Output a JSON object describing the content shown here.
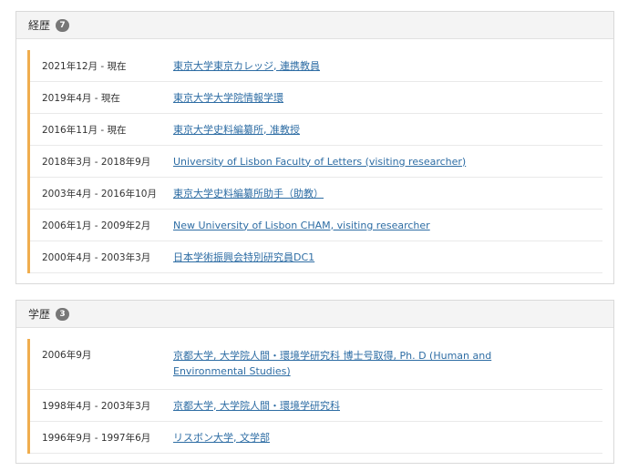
{
  "career": {
    "title": "経歴",
    "count": "7",
    "items": [
      {
        "date": "2021年12月 - 現在",
        "text": "東京大学東京カレッジ, 連携教員"
      },
      {
        "date": "2019年4月 - 現在",
        "text": "東京大学大学院情報学環"
      },
      {
        "date": "2016年11月 - 現在",
        "text": "東京大学史料編纂所, 准教授"
      },
      {
        "date": "2018年3月 - 2018年9月",
        "text": "University of Lisbon Faculty of Letters (visiting researcher)"
      },
      {
        "date": "2003年4月 - 2016年10月",
        "text": "東京大学史料編纂所助手（助教）"
      },
      {
        "date": "2006年1月 - 2009年2月",
        "text": "New University of Lisbon CHAM, visiting researcher"
      },
      {
        "date": "2000年4月 - 2003年3月",
        "text": "日本学術振興会特別研究員DC1"
      }
    ]
  },
  "education": {
    "title": "学歴",
    "count": "3",
    "items": [
      {
        "date": "2006年9月",
        "text": "京都大学, 大学院人間・環境学研究科 博士号取得, Ph. D (Human and Environmental Studies)"
      },
      {
        "date": "1998年4月 - 2003年3月",
        "text": "京都大学, 大学院人間・環境学研究科"
      },
      {
        "date": "1996年9月 - 1997年6月",
        "text": "リスボン大学, 文学部"
      }
    ]
  },
  "colors": {
    "accent": "#f0ad4e",
    "link": "#2e6da4",
    "badge": "#777777"
  }
}
